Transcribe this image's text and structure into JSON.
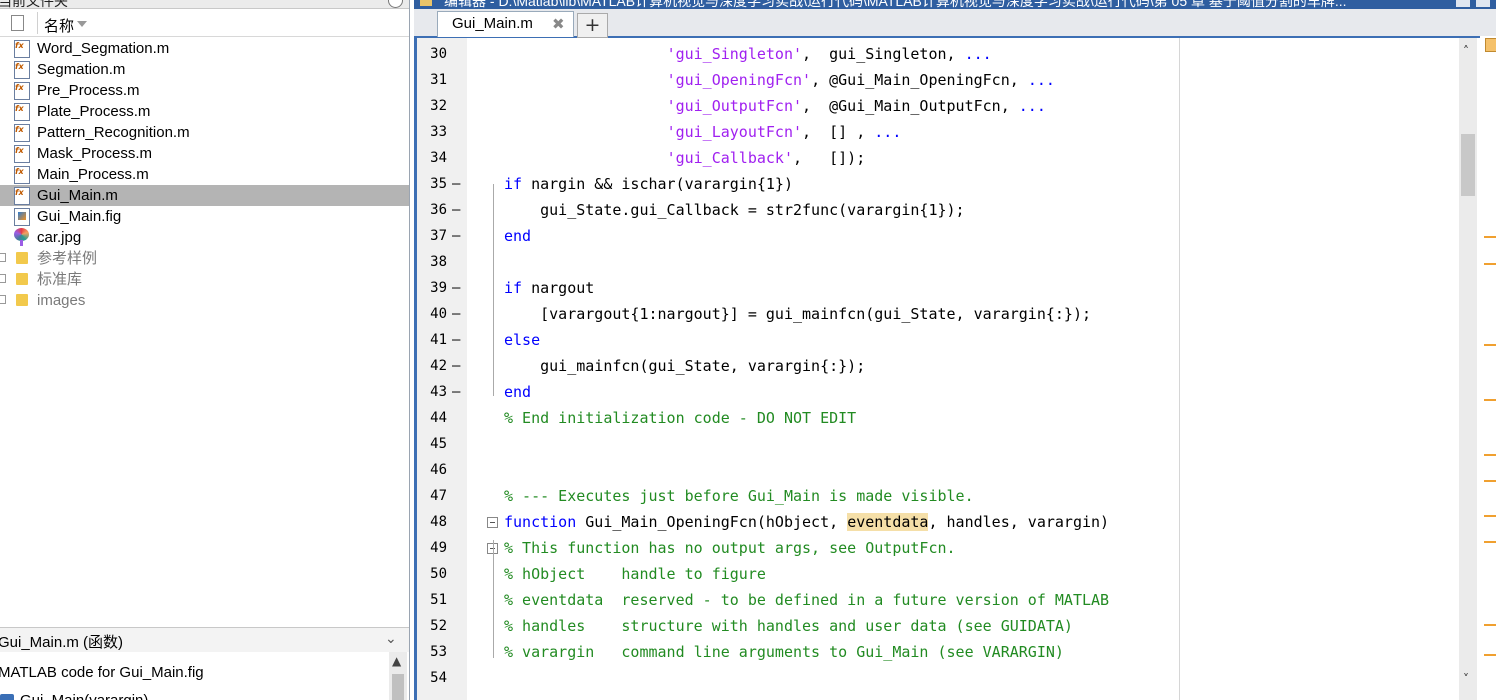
{
  "file_browser": {
    "panel_title": "当前文件夹",
    "column_name": "名称",
    "files": [
      {
        "name": "Word_Segmation.m",
        "type": "m"
      },
      {
        "name": "Segmation.m",
        "type": "m"
      },
      {
        "name": "Pre_Process.m",
        "type": "m"
      },
      {
        "name": "Plate_Process.m",
        "type": "m"
      },
      {
        "name": "Pattern_Recognition.m",
        "type": "m"
      },
      {
        "name": "Mask_Process.m",
        "type": "m"
      },
      {
        "name": "Main_Process.m",
        "type": "m"
      },
      {
        "name": "Gui_Main.m",
        "type": "m",
        "selected": true
      },
      {
        "name": "Gui_Main.fig",
        "type": "fig"
      },
      {
        "name": "car.jpg",
        "type": "jpg"
      },
      {
        "name": "参考样例",
        "type": "folder"
      },
      {
        "name": "标准库",
        "type": "folder"
      },
      {
        "name": "images",
        "type": "folder"
      }
    ]
  },
  "details": {
    "header": "Gui_Main.m  (函数)",
    "description": "MATLAB code for Gui_Main.fig",
    "item": "Gui_Main(varargin)"
  },
  "editor": {
    "title": "编辑器 - D:\\Matlab\\lib\\MATLAB计算机视觉与深度学习实战\\运行代码\\MATLAB计算机视觉与深度学习实战\\运行代码\\第 05 章 基于阈值分割的车牌...",
    "tab_label": "Gui_Main.m",
    "close_glyph": "✖",
    "add_tab_glyph": "+",
    "lines": [
      {
        "n": "30",
        "dash": false
      },
      {
        "n": "31",
        "dash": false
      },
      {
        "n": "32",
        "dash": false
      },
      {
        "n": "33",
        "dash": false
      },
      {
        "n": "34",
        "dash": false
      },
      {
        "n": "35",
        "dash": true
      },
      {
        "n": "36",
        "dash": true
      },
      {
        "n": "37",
        "dash": true
      },
      {
        "n": "38",
        "dash": false
      },
      {
        "n": "39",
        "dash": true
      },
      {
        "n": "40",
        "dash": true
      },
      {
        "n": "41",
        "dash": true
      },
      {
        "n": "42",
        "dash": true
      },
      {
        "n": "43",
        "dash": true
      },
      {
        "n": "44",
        "dash": false
      },
      {
        "n": "45",
        "dash": false
      },
      {
        "n": "46",
        "dash": false
      },
      {
        "n": "47",
        "dash": false
      },
      {
        "n": "48",
        "dash": false
      },
      {
        "n": "49",
        "dash": false
      },
      {
        "n": "50",
        "dash": false
      },
      {
        "n": "51",
        "dash": false
      },
      {
        "n": "52",
        "dash": false
      },
      {
        "n": "53",
        "dash": false
      },
      {
        "n": "54",
        "dash": false
      }
    ],
    "code": {
      "l30a": "                  ",
      "l30s": "'gui_Singleton'",
      "l30b": ",  gui_Singleton, ",
      "l30k": "...",
      "l31a": "                  ",
      "l31s": "'gui_OpeningFcn'",
      "l31b": ", @Gui_Main_OpeningFcn, ",
      "l31k": "...",
      "l32a": "                  ",
      "l32s": "'gui_OutputFcn'",
      "l32b": ",  @Gui_Main_OutputFcn, ",
      "l32k": "...",
      "l33a": "                  ",
      "l33s": "'gui_LayoutFcn'",
      "l33b": ",  [] , ",
      "l33k": "...",
      "l34a": "                  ",
      "l34s": "'gui_Callback'",
      "l34b": ",   []);",
      "l35k": "if",
      "l35b": " nargin && ischar(varargin{1})",
      "l36": "    gui_State.gui_Callback = str2func(varargin{1});",
      "l37k": "end",
      "l39k": "if",
      "l39b": " nargout",
      "l40": "    [varargout{1:nargout}] = gui_mainfcn(gui_State, varargin{:});",
      "l41k": "else",
      "l42": "    gui_mainfcn(gui_State, varargin{:});",
      "l43k": "end",
      "l44c": "% End initialization code - DO NOT EDIT",
      "l47c": "% --- Executes just before Gui_Main is made visible.",
      "l48k": "function",
      "l48a": " Gui_Main_OpeningFcn(hObject, ",
      "l48h": "eventdata",
      "l48b": ", handles, varargin)",
      "l49c": "% This function has no output args, see OutputFcn.",
      "l50c": "% hObject    handle to figure",
      "l51c": "% eventdata  reserved - to be defined in a future version of MATLAB",
      "l52c": "% handles    structure with handles and user data (see GUIDATA)",
      "l53c": "% varargin   command line arguments to Gui_Main (see VARARGIN)"
    }
  },
  "colors": {
    "keyword": "#0000ff",
    "string": "#a020f0",
    "comment": "#228b22",
    "selection": "#b4b4b4",
    "highlight": "#f5dfa8"
  }
}
